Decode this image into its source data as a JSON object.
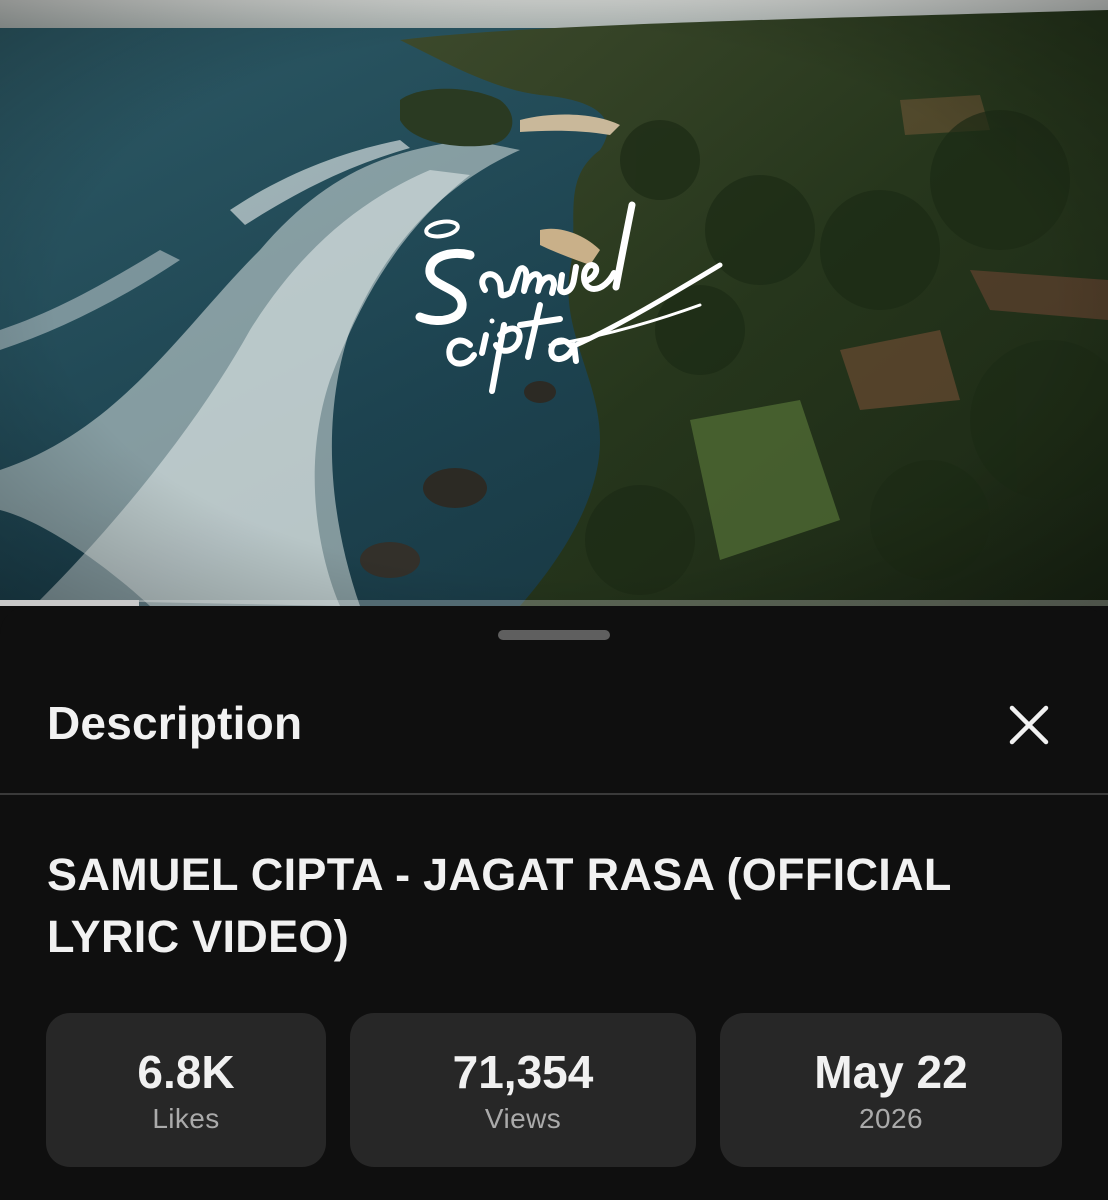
{
  "player": {
    "progress_fraction": 0.125,
    "logo_text": "Samuel cipta"
  },
  "sheet": {
    "title": "Description",
    "close_icon": "close-icon"
  },
  "video": {
    "title": "SAMUEL CIPTA - JAGAT RASA (OFFICIAL LYRIC VIDEO)"
  },
  "stats": [
    {
      "value": "6.8K",
      "label": "Likes"
    },
    {
      "value": "71,354",
      "label": "Views"
    },
    {
      "value": "May 22",
      "label": "2026"
    }
  ]
}
